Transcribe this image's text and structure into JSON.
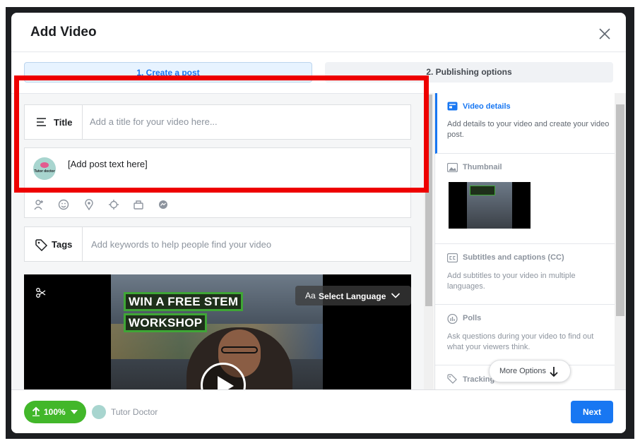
{
  "dialog": {
    "title": "Add Video"
  },
  "steps": [
    {
      "label": "1. Create a post",
      "active": true
    },
    {
      "label": "2. Publishing options",
      "active": false
    }
  ],
  "form": {
    "title_label": "Title",
    "title_placeholder": "Add a title for your video here...",
    "post_placeholder": "[Add post text here]",
    "post_icons": [
      "tag-people-icon",
      "feeling-icon",
      "location-icon",
      "checkin-icon",
      "sponsor-icon",
      "messenger-icon"
    ],
    "tags_label": "Tags",
    "tags_placeholder": "Add keywords to help people find your video"
  },
  "video": {
    "banner_line1": "WIN A FREE STEM",
    "banner_line2": "WORKSHOP",
    "language_icon": "Aa",
    "language_label": "Select Language"
  },
  "sidebar": {
    "sections": [
      {
        "title": "Video details",
        "description": "Add details to your video and create your video post.",
        "active": true
      },
      {
        "title": "Thumbnail"
      },
      {
        "title": "Subtitles and captions (CC)",
        "description": "Add subtitles to your video in multiple languages."
      },
      {
        "title": "Polls",
        "description": "Ask questions during your video to find out what your viewers think."
      },
      {
        "title": "Tracking"
      }
    ],
    "more_options": "More Options"
  },
  "footer": {
    "upload_progress": "100%",
    "page_name": "Tutor Doctor",
    "next_label": "Next"
  },
  "avatar_text": "Tutor doctor",
  "colors": {
    "accent": "#1877f2",
    "upload_green": "#42b72a",
    "highlight_red": "#ee0000"
  }
}
